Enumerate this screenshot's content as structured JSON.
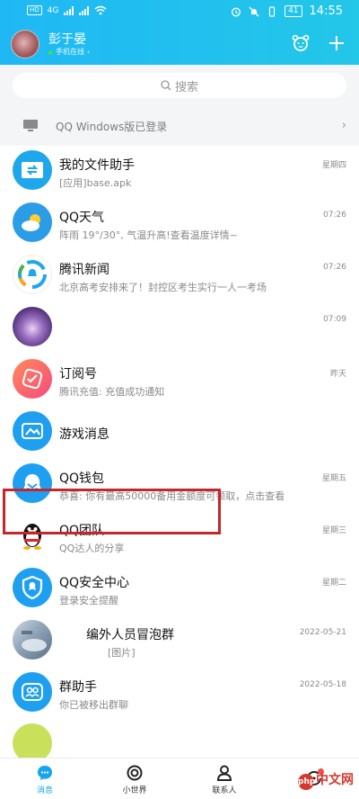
{
  "status_bar": {
    "time": "14:55",
    "battery": "41",
    "network_label": "4G"
  },
  "profile": {
    "name": "彭于晏",
    "status": "手机在线"
  },
  "search": {
    "placeholder": "搜索"
  },
  "pc_login": {
    "text": "QQ Windows版已登录"
  },
  "chats": [
    {
      "title": "我的文件助手",
      "subtitle": "[应用]base.apk",
      "time": "星期四",
      "icon": "file-transfer-icon"
    },
    {
      "title": "QQ天气",
      "subtitle": "阵雨 19°/30°, 气温升高!查看温度详情~",
      "time": "07:26",
      "icon": "weather-icon"
    },
    {
      "title": "腾讯新闻",
      "subtitle": "北京高考安排来了！封控区考生实行一人一考场",
      "time": "07:26",
      "icon": "tencent-news-icon"
    },
    {
      "title": "",
      "subtitle": "",
      "time": "07:09",
      "icon": "user-avatar"
    },
    {
      "title": "订阅号",
      "subtitle": "腾讯充值: 充值成功通知",
      "time": "昨天",
      "icon": "subscription-icon"
    },
    {
      "title": "游戏消息",
      "subtitle": "",
      "time": "",
      "icon": "game-icon"
    },
    {
      "title": "QQ钱包",
      "subtitle": "恭喜: 你有最高50000备用金额度可领取，点击查看",
      "time": "星期五",
      "icon": "wallet-icon"
    },
    {
      "title": "QQ团队",
      "subtitle": "QQ达人的分享",
      "time": "星期三",
      "icon": "penguin-icon"
    },
    {
      "title": "QQ安全中心",
      "subtitle": "登录安全提醒",
      "time": "星期二",
      "icon": "security-shield-icon"
    },
    {
      "title": "编外人员冒泡群",
      "subtitle": "[图片]",
      "time": "2022-05-21",
      "icon": "group-avatar"
    },
    {
      "title": "群助手",
      "subtitle": "你已被移出群聊",
      "time": "2022-05-18",
      "icon": "group-helper-icon"
    }
  ],
  "bottom_nav": [
    {
      "label": "消息",
      "active": true
    },
    {
      "label": "小世界",
      "active": false
    },
    {
      "label": "联系人",
      "active": false
    },
    {
      "label": "",
      "active": false
    }
  ],
  "watermark": {
    "badge": "php",
    "text": "中文网"
  },
  "colors": {
    "accent": "#19a4ee",
    "highlight": "#c4262b"
  }
}
